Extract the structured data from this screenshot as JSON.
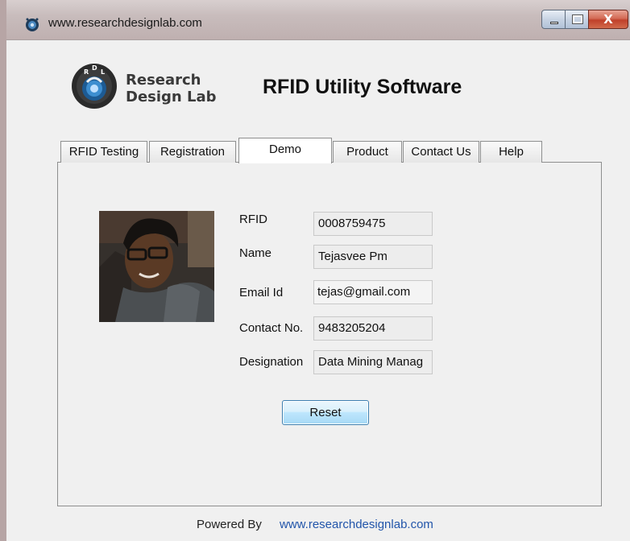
{
  "window": {
    "title": "www.researchdesignlab.com",
    "titlebar_color": "#c8bcbc",
    "close_glyph": "X"
  },
  "header": {
    "brand_line1": "Research",
    "brand_line2": "Design Lab",
    "logo_letters": [
      "R",
      "D",
      "L"
    ],
    "app_title": "RFID Utility Software"
  },
  "tabs": [
    {
      "label": "RFID Testing",
      "active": false
    },
    {
      "label": "Registration",
      "active": false
    },
    {
      "label": "Demo",
      "active": true
    },
    {
      "label": "Product",
      "active": false
    },
    {
      "label": "Contact Us",
      "active": false
    },
    {
      "label": "Help",
      "active": false
    }
  ],
  "form": {
    "rfid_label": "RFID",
    "rfid_value": "0008759475",
    "name_label": "Name",
    "name_value": "Tejasvee Pm",
    "email_label": "Email Id",
    "email_value": "tejas@gmail.com",
    "contact_label": "Contact No.",
    "contact_value": "9483205204",
    "designation_label": "Designation",
    "designation_value": "Data Mining Manag"
  },
  "actions": {
    "reset_label": "Reset"
  },
  "footer": {
    "label": "Powered By",
    "link": "www.researchdesignlab.com"
  },
  "icons": [
    "app-icon",
    "minimize-icon",
    "maximize-icon",
    "close-icon",
    "rdl-logo-icon"
  ],
  "colors": {
    "link": "#2255aa",
    "close_button": "#c0402a",
    "reset_border": "#3c7fb1"
  }
}
